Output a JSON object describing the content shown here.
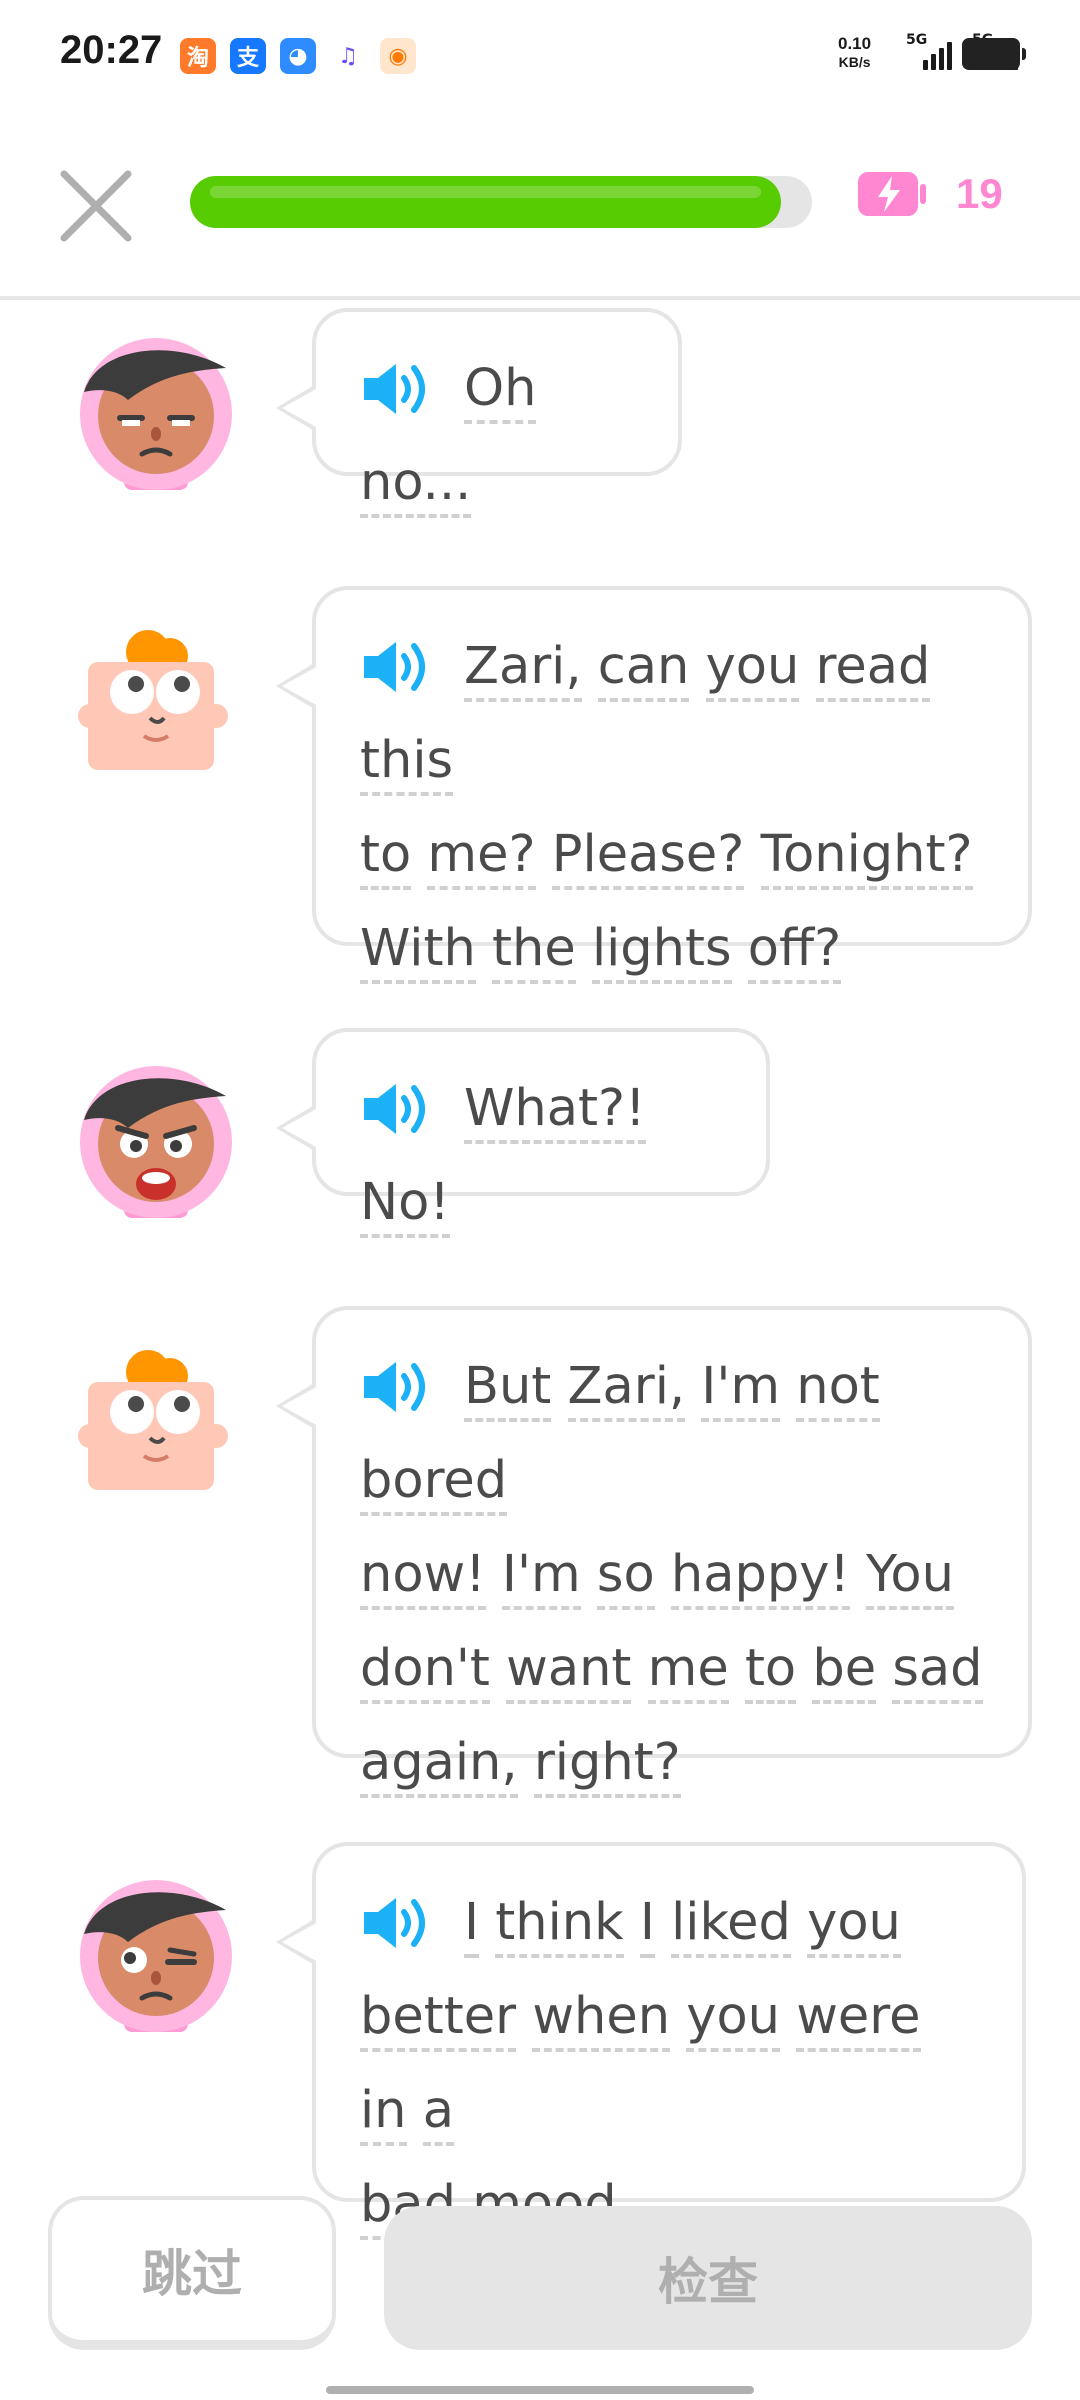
{
  "status_bar": {
    "time": "20:27",
    "net_speed_value": "0.10",
    "net_speed_unit": "KB/s",
    "signal1_label": "5G",
    "signal2_label": "5G",
    "app_icons": [
      "taobao-icon",
      "alipay-icon",
      "browser-icon",
      "music-icon",
      "store-icon"
    ]
  },
  "header": {
    "progress_fraction": 0.95,
    "energy_count": "19",
    "energy_color": "#ff86d0",
    "progress_color": "#58cc02"
  },
  "messages": [
    {
      "speaker": "Zari",
      "lines": [
        [
          "Oh",
          "no..."
        ]
      ]
    },
    {
      "speaker": "Junior",
      "lines": [
        [
          "Zari,",
          "can",
          "you",
          "read",
          "this"
        ],
        [
          "to",
          "me?",
          "Please?",
          "Tonight?"
        ],
        [
          "With",
          "the",
          "lights",
          "off?"
        ]
      ]
    },
    {
      "speaker": "Zari",
      "lines": [
        [
          "What?!",
          "No!"
        ]
      ]
    },
    {
      "speaker": "Junior",
      "lines": [
        [
          "But",
          "Zari,",
          "I'm",
          "not",
          "bored"
        ],
        [
          "now!",
          "I'm",
          "so",
          "happy!",
          "You"
        ],
        [
          "don't",
          "want",
          "me",
          "to",
          "be",
          "sad"
        ],
        [
          "again,",
          "right?"
        ]
      ]
    },
    {
      "speaker": "Zari",
      "lines": [
        [
          "I",
          "think",
          "I",
          "liked",
          "you"
        ],
        [
          "better",
          "when",
          "you",
          "were",
          "in",
          "a"
        ],
        [
          "bad",
          "mood."
        ]
      ]
    }
  ],
  "buttons": {
    "skip_label": "跳过",
    "check_label": "检查"
  }
}
